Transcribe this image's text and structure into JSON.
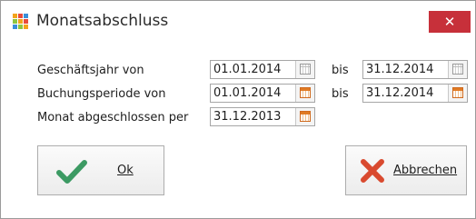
{
  "window": {
    "title": "Monatsabschluss",
    "close_label": "✕"
  },
  "form": {
    "rows": [
      {
        "label": "Geschäftsjahr von",
        "from": "01.01.2014",
        "to_label": "bis",
        "to": "31.12.2014"
      },
      {
        "label": "Buchungsperiode von",
        "from": "01.01.2014",
        "to_label": "bis",
        "to": "31.12.2014"
      },
      {
        "label": "Monat abgeschlossen per",
        "from": "31.12.2013"
      }
    ]
  },
  "buttons": {
    "ok_label": "Ok",
    "cancel_label": "Abbrechen"
  },
  "colors": {
    "close_bg": "#c7303a",
    "ok_check": "#3c9a63",
    "cancel_x": "#d94a2f",
    "calendar_active": "#e07b24"
  },
  "icons": {
    "app": "grid-app-icon",
    "close": "close-icon",
    "calendar": "calendar-icon",
    "ok": "checkmark-icon",
    "cancel": "x-cross-icon"
  }
}
